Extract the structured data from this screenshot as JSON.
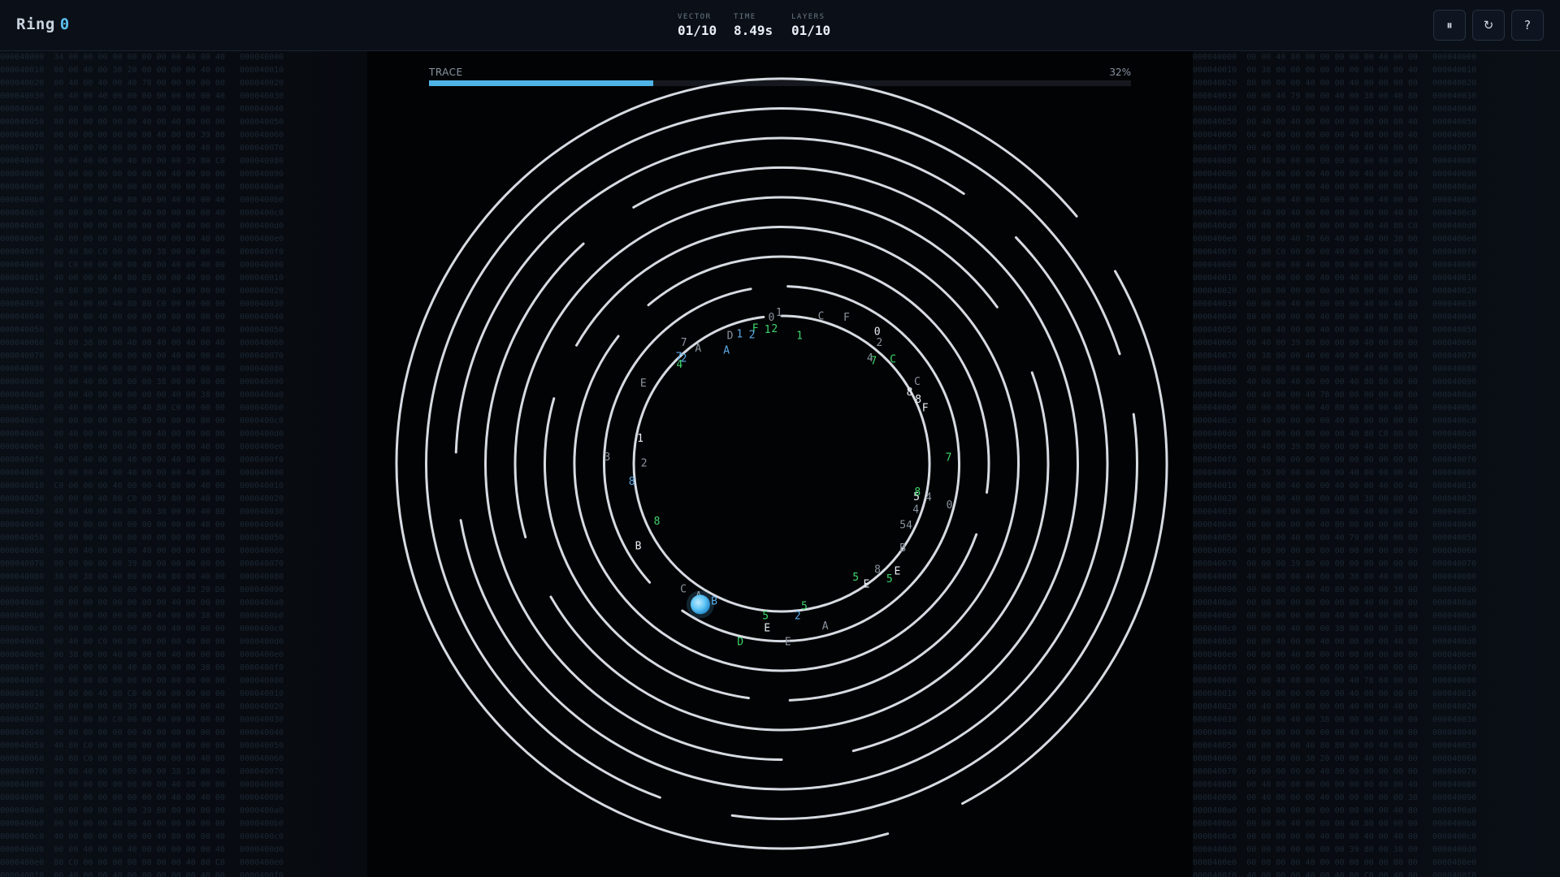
{
  "header": {
    "title": "Ring",
    "level": "0",
    "stats": {
      "vector": {
        "label": "VECTOR",
        "value": "01/10"
      },
      "time": {
        "label": "TIME",
        "value": "8.49s"
      },
      "layers": {
        "label": "LAYERS",
        "value": "01/10"
      }
    },
    "controls": {
      "pause": {
        "icon": "pause-icon",
        "glyph": "⏸"
      },
      "restart": {
        "icon": "restart-icon",
        "glyph": "↻"
      },
      "help": {
        "icon": "help-icon",
        "glyph": "?"
      }
    }
  },
  "trace": {
    "label": "TRACE",
    "percent_text": "32%",
    "fraction": 0.32
  },
  "maze": {
    "ring_count": 9,
    "colors": {
      "ring": "#d6dbe2",
      "glyph_white": "#e8eef5",
      "glyph_grey": "#8a939e",
      "glyph_green": "#3fd66b",
      "glyph_blue": "#5aa9e6",
      "player": "#5cc4f5",
      "accent": "#4fb3e6"
    },
    "rings": [
      {
        "ring": 1,
        "gaps": [
          [
            90,
            97
          ]
        ]
      },
      {
        "ring": 2,
        "gaps": [
          [
            88,
            100
          ],
          [
            222,
            236
          ]
        ]
      },
      {
        "ring": 3,
        "gaps": [
          [
            130,
            142
          ],
          [
            340,
            352
          ]
        ]
      },
      {
        "ring": 4,
        "gaps": [
          [
            150,
            164
          ],
          [
            262,
            272
          ]
        ]
      },
      {
        "ring": 5,
        "gaps": [
          [
            20,
            36
          ],
          [
            196,
            210
          ]
        ]
      },
      {
        "ring": 6,
        "gaps": [
          [
            120,
            132
          ],
          [
            270,
            284
          ]
        ]
      },
      {
        "ring": 7,
        "gaps": [
          [
            44,
            56
          ],
          [
            178,
            190
          ]
        ]
      },
      {
        "ring": 8,
        "gaps": [
          [
            250,
            262
          ],
          [
            8,
            18
          ]
        ]
      },
      {
        "ring": 9,
        "gaps": [
          [
            30,
            40
          ],
          [
            286,
            298
          ]
        ]
      }
    ],
    "glyphs": [
      {
        "t": "1",
        "a": 91,
        "r": 1.02,
        "c": "glyph_grey"
      },
      {
        "t": "0",
        "a": 94,
        "r": 0.99,
        "c": "glyph_grey"
      },
      {
        "t": "C",
        "a": 75,
        "r": 1.03,
        "c": "glyph_grey"
      },
      {
        "t": "F",
        "a": 66,
        "r": 1.08,
        "c": "glyph_grey"
      },
      {
        "t": "0",
        "a": 54,
        "r": 1.1,
        "c": "glyph_white"
      },
      {
        "t": "2",
        "a": 51,
        "r": 1.05,
        "c": "glyph_grey"
      },
      {
        "t": "C",
        "a": 43,
        "r": 1.03,
        "c": "glyph_green"
      },
      {
        "t": "4",
        "a": 50,
        "r": 0.93,
        "c": "glyph_grey"
      },
      {
        "t": "7",
        "a": 48,
        "r": 0.93,
        "c": "glyph_green"
      },
      {
        "t": "1",
        "a": 82,
        "r": 0.87,
        "c": "glyph_green"
      },
      {
        "t": "1",
        "a": 96,
        "r": 0.91,
        "c": "glyph_green"
      },
      {
        "t": "2",
        "a": 93,
        "r": 0.91,
        "c": "glyph_green"
      },
      {
        "t": "F",
        "a": 101,
        "r": 0.93,
        "c": "glyph_green"
      },
      {
        "t": "2",
        "a": 103,
        "r": 0.89,
        "c": "glyph_blue"
      },
      {
        "t": "1",
        "a": 108,
        "r": 0.92,
        "c": "glyph_blue"
      },
      {
        "t": "D",
        "a": 112,
        "r": 0.93,
        "c": "glyph_grey"
      },
      {
        "t": "A",
        "a": 116,
        "r": 0.85,
        "c": "glyph_blue"
      },
      {
        "t": "A",
        "a": 126,
        "r": 0.96,
        "c": "glyph_grey"
      },
      {
        "t": "7",
        "a": 129,
        "r": 1.05,
        "c": "glyph_grey"
      },
      {
        "t": "7",
        "a": 134,
        "r": 1.0,
        "c": "glyph_blue"
      },
      {
        "t": "2",
        "a": 133,
        "r": 0.97,
        "c": "glyph_blue"
      },
      {
        "t": "4",
        "a": 136,
        "r": 0.96,
        "c": "glyph_green"
      },
      {
        "t": "E",
        "a": 150,
        "r": 1.08,
        "c": "glyph_grey"
      },
      {
        "t": "1",
        "a": 170,
        "r": 0.97,
        "c": "glyph_white"
      },
      {
        "t": "3",
        "a": 178,
        "r": 1.18,
        "c": "glyph_grey"
      },
      {
        "t": "2",
        "a": 180,
        "r": 0.93,
        "c": "glyph_grey"
      },
      {
        "t": "8",
        "a": 187,
        "r": 1.02,
        "c": "glyph_blue"
      },
      {
        "t": "8",
        "a": 205,
        "r": 0.93,
        "c": "glyph_green"
      },
      {
        "t": "B",
        "a": 210,
        "r": 1.12,
        "c": "glyph_white"
      },
      {
        "t": "C",
        "a": 232,
        "r": 1.08,
        "c": "glyph_grey"
      },
      {
        "t": "A",
        "a": 238,
        "r": 1.06,
        "c": "glyph_grey"
      },
      {
        "t": "B",
        "a": 244,
        "r": 1.04,
        "c": "glyph_blue"
      },
      {
        "t": "5",
        "a": 264,
        "r": 1.04,
        "c": "glyph_green"
      },
      {
        "t": "E",
        "a": 265,
        "r": 1.12,
        "c": "glyph_white"
      },
      {
        "t": "D",
        "a": 257,
        "r": 1.24,
        "c": "glyph_green"
      },
      {
        "t": "E",
        "a": 272,
        "r": 1.21,
        "c": "glyph_grey"
      },
      {
        "t": "2",
        "a": 276,
        "r": 1.04,
        "c": "glyph_blue"
      },
      {
        "t": "5",
        "a": 279,
        "r": 0.98,
        "c": "glyph_green"
      },
      {
        "t": "A",
        "a": 285,
        "r": 1.14,
        "c": "glyph_grey"
      },
      {
        "t": "5",
        "a": 303,
        "r": 0.92,
        "c": "glyph_green"
      },
      {
        "t": "E",
        "a": 305,
        "r": 1.0,
        "c": "glyph_white"
      },
      {
        "t": "8",
        "a": 312,
        "r": 0.97,
        "c": "glyph_grey"
      },
      {
        "t": "5",
        "a": 313,
        "r": 1.07,
        "c": "glyph_green"
      },
      {
        "t": "E",
        "a": 317,
        "r": 1.07,
        "c": "glyph_white"
      },
      {
        "t": "B",
        "a": 325,
        "r": 1.0,
        "c": "glyph_grey"
      },
      {
        "t": "5",
        "a": 333,
        "r": 0.92,
        "c": "glyph_grey"
      },
      {
        "t": "4",
        "a": 334,
        "r": 0.96,
        "c": "glyph_grey"
      },
      {
        "t": "4",
        "a": 341,
        "r": 0.96,
        "c": "glyph_grey"
      },
      {
        "t": "5",
        "a": 346,
        "r": 0.94,
        "c": "glyph_white"
      },
      {
        "t": "8",
        "a": 348,
        "r": 0.94,
        "c": "glyph_green"
      },
      {
        "t": "4",
        "a": 347,
        "r": 1.02,
        "c": "glyph_grey"
      },
      {
        "t": "0",
        "a": 346,
        "r": 1.17,
        "c": "glyph_grey"
      },
      {
        "t": "7",
        "a": 2,
        "r": 1.13,
        "c": "glyph_green"
      },
      {
        "t": "F",
        "a": 21,
        "r": 1.04,
        "c": "glyph_white"
      },
      {
        "t": "8",
        "a": 25,
        "r": 1.02,
        "c": "glyph_white"
      },
      {
        "t": "8",
        "a": 29,
        "r": 0.99,
        "c": "glyph_white"
      },
      {
        "t": "C",
        "a": 31,
        "r": 1.07,
        "c": "glyph_grey"
      }
    ],
    "player": {
      "angle": 240,
      "ring_position": 0.5
    }
  }
}
